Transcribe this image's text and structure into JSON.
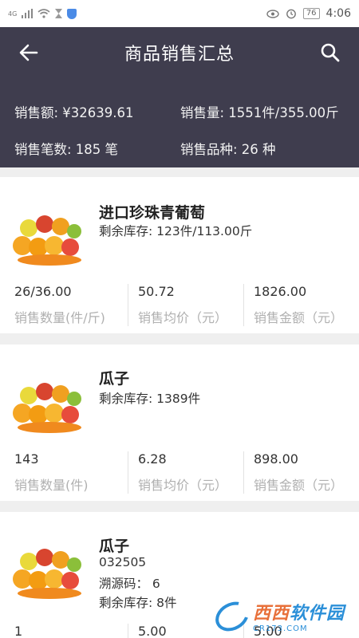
{
  "status": {
    "network": "4G",
    "battery": "76",
    "time": "4:06"
  },
  "header": {
    "title": "商品销售汇总",
    "stats": {
      "amount": "销售额: ¥32639.61",
      "quantity": "销售量: 1551件/355.00斤",
      "orders": "销售笔数: 185 笔",
      "kinds": "销售品种: 26 种"
    }
  },
  "products": [
    {
      "name": "进口珍珠青葡萄",
      "lines": [
        "剩余库存: 123件/113.00斤"
      ],
      "metrics": [
        {
          "value": "26/36.00",
          "label": "销售数量(件/斤)"
        },
        {
          "value": "50.72",
          "label": "销售均价（元）"
        },
        {
          "value": "1826.00",
          "label": "销售金额（元）"
        }
      ]
    },
    {
      "name": "瓜子",
      "lines": [
        "剩余库存: 1389件"
      ],
      "metrics": [
        {
          "value": "143",
          "label": "销售数量(件)"
        },
        {
          "value": "6.28",
          "label": "销售均价（元）"
        },
        {
          "value": "898.00",
          "label": "销售金额（元）"
        }
      ]
    },
    {
      "name": "瓜子",
      "lines": [
        "032505",
        "溯源码： 6",
        "剩余库存: 8件"
      ],
      "metrics": [
        {
          "value": "1",
          "label": ""
        },
        {
          "value": "5.00",
          "label": ""
        },
        {
          "value": "5.00",
          "label": ""
        }
      ]
    }
  ],
  "watermark": {
    "main": "西西",
    "side": "软件园",
    "sub": "CR173.COM"
  }
}
